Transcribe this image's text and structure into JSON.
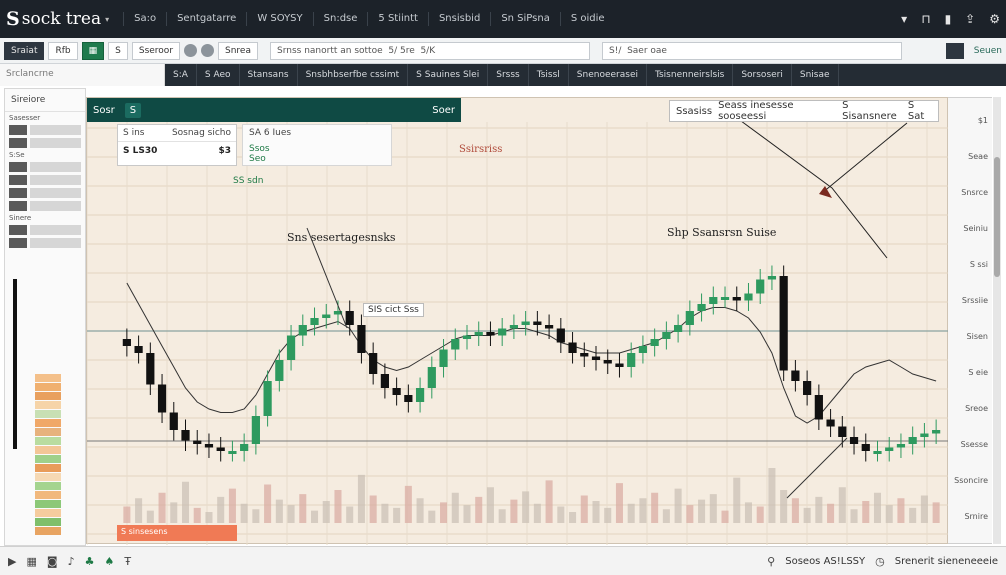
{
  "app": {
    "title": "sock  trea",
    "logo_mark": "S"
  },
  "top_menu": [
    "Sa:o",
    "Sentgatarre",
    "W SOYSY",
    "Sn:dse",
    "5 Stiintt",
    "Snsisbid",
    "Sn SiPsna",
    "S oidie"
  ],
  "toolbar": {
    "btn1": "Sraiat",
    "btn2": "Rfb",
    "btn3": "S",
    "btn4": "Sseroor",
    "btn5": "Snrea",
    "search1": "Srnss nanortt an sottoe  5/ 5re  5/K",
    "search2": "S!/  Saer oae"
  },
  "brand_tag": "Seuen",
  "crumb": "Srclancrne",
  "nav": [
    "S:A",
    "S Aeo",
    "Stansans",
    "Snsbhbserfbe cssimt",
    "S Sauines Slei",
    "Srsss",
    "Tsissl",
    "Snenoeerasei",
    "Tsisnenneirslsis",
    "Sorsoseri",
    "Snisae"
  ],
  "sidebar": {
    "title": "Sireiore",
    "labels": [
      "Sasesser",
      "S:Se",
      "Sinere"
    ]
  },
  "chart_header": {
    "left": "Sosr",
    "pill": "S",
    "right": "Soer"
  },
  "info_panel": {
    "col1": "S ins",
    "col2": "Sosnag sicho",
    "value_label": "S LS30",
    "value": "$3"
  },
  "info_panel2": {
    "line1": "SA  6 Iues",
    "line2": "Ssos",
    "line3": "Seo"
  },
  "legend": {
    "a": "Ssasiss",
    "b": "Seass inesesse sooseessi",
    "c": "S  Sisansnere",
    "d": "S  Sat"
  },
  "annotations": {
    "a1": "Ssirsriss",
    "a2": "SS sdn",
    "a3": "Sns sesertagesnsks",
    "a4": "Shp Ssansrsn   Suise",
    "a5": "SIS cict Sss"
  },
  "bottom_label": "S sinsesens",
  "price_ticks": [
    "$1",
    "Seae",
    "Snsrce",
    "Seiniu",
    "S ssi",
    "Srssiie",
    "Sisen",
    "S eie",
    "Sreoe",
    "Ssesse",
    "Ssoncire",
    "Srnire"
  ],
  "bottombar": {
    "stat1": "Soseos  AS!LSSY",
    "stat2": "Srenerit sieneneeeie"
  },
  "colors": {
    "up": "#2e9a5f",
    "down": "#111111",
    "accent": "#0f4a44",
    "chart_bg": "#f5ece0"
  },
  "chart_data": {
    "type": "candlestick",
    "x": [
      1,
      2,
      3,
      4,
      5,
      6,
      7,
      8,
      9,
      10,
      11,
      12,
      13,
      14,
      15,
      16,
      17,
      18,
      19,
      20,
      21,
      22,
      23,
      24,
      25,
      26,
      27,
      28,
      29,
      30,
      31,
      32,
      33,
      34,
      35,
      36,
      37,
      38,
      39,
      40,
      41,
      42,
      43,
      44,
      45,
      46,
      47,
      48,
      49,
      50,
      51,
      52,
      53,
      54,
      55,
      56,
      57,
      58,
      59,
      60,
      61,
      62,
      63,
      64,
      65,
      66,
      67,
      68,
      69,
      70
    ],
    "close": [
      52,
      50,
      41,
      33,
      28,
      25,
      24,
      23,
      22,
      22,
      24,
      32,
      42,
      48,
      55,
      58,
      60,
      61,
      62,
      58,
      50,
      44,
      40,
      38,
      36,
      40,
      46,
      51,
      54,
      55,
      56,
      55,
      57,
      58,
      59,
      58,
      57,
      53,
      50,
      49,
      48,
      47,
      46,
      50,
      52,
      54,
      56,
      58,
      62,
      64,
      66,
      66,
      65,
      67,
      71,
      72,
      45,
      42,
      38,
      31,
      29,
      26,
      24,
      22,
      22,
      23,
      24,
      26,
      27,
      28
    ],
    "series": [
      {
        "name": "price",
        "values": [
          52,
          50,
          41,
          33,
          28,
          25,
          24,
          23,
          22,
          22,
          24,
          32,
          42,
          48,
          55,
          58,
          60,
          61,
          62,
          58,
          50,
          44,
          40,
          38,
          36,
          40,
          46,
          51,
          54,
          55,
          56,
          55,
          57,
          58,
          59,
          58,
          57,
          53,
          50,
          49,
          48,
          47,
          46,
          50,
          52,
          54,
          56,
          58,
          62,
          64,
          66,
          66,
          65,
          67,
          71,
          72,
          45,
          42,
          38,
          31,
          29,
          26,
          24,
          22,
          22,
          23,
          24,
          26,
          27,
          28
        ]
      },
      {
        "name": "trend",
        "values": [
          70,
          64,
          58,
          52,
          46,
          40,
          36,
          34,
          33,
          33,
          34,
          38,
          44,
          50,
          54,
          56,
          57,
          58,
          59,
          57,
          52,
          48,
          46,
          45,
          46,
          48,
          50,
          52,
          54,
          55,
          55,
          55,
          56,
          57,
          57,
          56,
          55,
          53,
          52,
          51,
          50,
          50,
          50,
          51,
          52,
          53,
          55,
          57,
          60,
          62,
          63,
          63,
          62,
          60,
          56,
          50,
          40,
          32,
          30,
          32,
          36,
          40,
          44,
          46,
          47,
          48,
          46,
          44,
          43,
          42
        ]
      }
    ],
    "volume": [
      12,
      18,
      9,
      22,
      15,
      30,
      11,
      8,
      19,
      25,
      14,
      10,
      28,
      17,
      13,
      21,
      9,
      16,
      24,
      12,
      35,
      20,
      14,
      11,
      27,
      18,
      9,
      15,
      22,
      13,
      19,
      26,
      10,
      17,
      23,
      14,
      31,
      12,
      8,
      20,
      16,
      11,
      29,
      14,
      18,
      22,
      10,
      25,
      13,
      17,
      21,
      9,
      33,
      15,
      12,
      40,
      24,
      18,
      11,
      19,
      14,
      26,
      10,
      16,
      22,
      13,
      18,
      11,
      20,
      15
    ]
  }
}
